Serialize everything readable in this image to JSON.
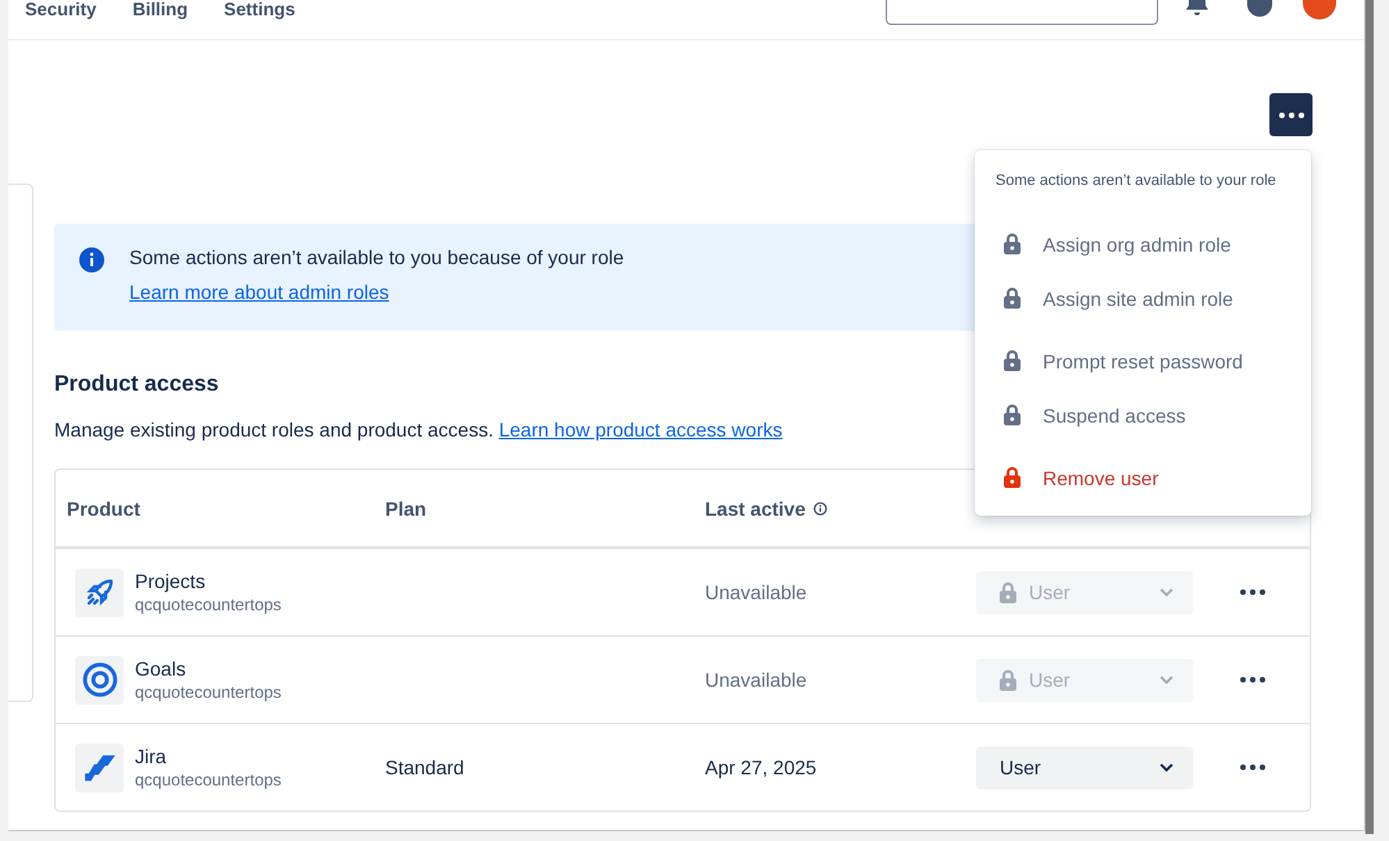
{
  "top_nav": {
    "items": [
      {
        "label": "Security"
      },
      {
        "label": "Billing"
      },
      {
        "label": "Settings"
      }
    ]
  },
  "banner": {
    "message": "Some actions aren’t available to you because of your role",
    "link": "Learn more about admin roles"
  },
  "section": {
    "title": "Product access",
    "description": "Manage existing product roles and product access.",
    "link": "Learn how product access works"
  },
  "table": {
    "columns": [
      {
        "label": "Product",
        "info": false
      },
      {
        "label": "Plan",
        "info": false
      },
      {
        "label": "Last active",
        "info": true
      }
    ],
    "rows": [
      {
        "product": "Projects",
        "kind": "rocket",
        "site": "qcquotecountertops",
        "plan": "",
        "last_active": "Unavailable",
        "role": "User",
        "disabled": true
      },
      {
        "product": "Goals",
        "kind": "target",
        "site": "qcquotecountertops",
        "plan": "",
        "last_active": "Unavailable",
        "role": "User",
        "disabled": true
      },
      {
        "product": "Jira",
        "kind": "jira",
        "site": "qcquotecountertops",
        "plan": "Standard",
        "last_active": "Apr 27, 2025",
        "role": "User",
        "disabled": false
      }
    ]
  },
  "menu": {
    "expanded": true,
    "note": "Some actions aren’t available to your role",
    "items": [
      {
        "label": "Assign org admin role",
        "danger": false
      },
      {
        "label": "Assign site admin role",
        "danger": false
      },
      {
        "label": "Prompt reset password",
        "danger": false
      },
      {
        "label": "Suspend access",
        "danger": false
      },
      {
        "label": "Remove user",
        "danger": true
      }
    ]
  }
}
